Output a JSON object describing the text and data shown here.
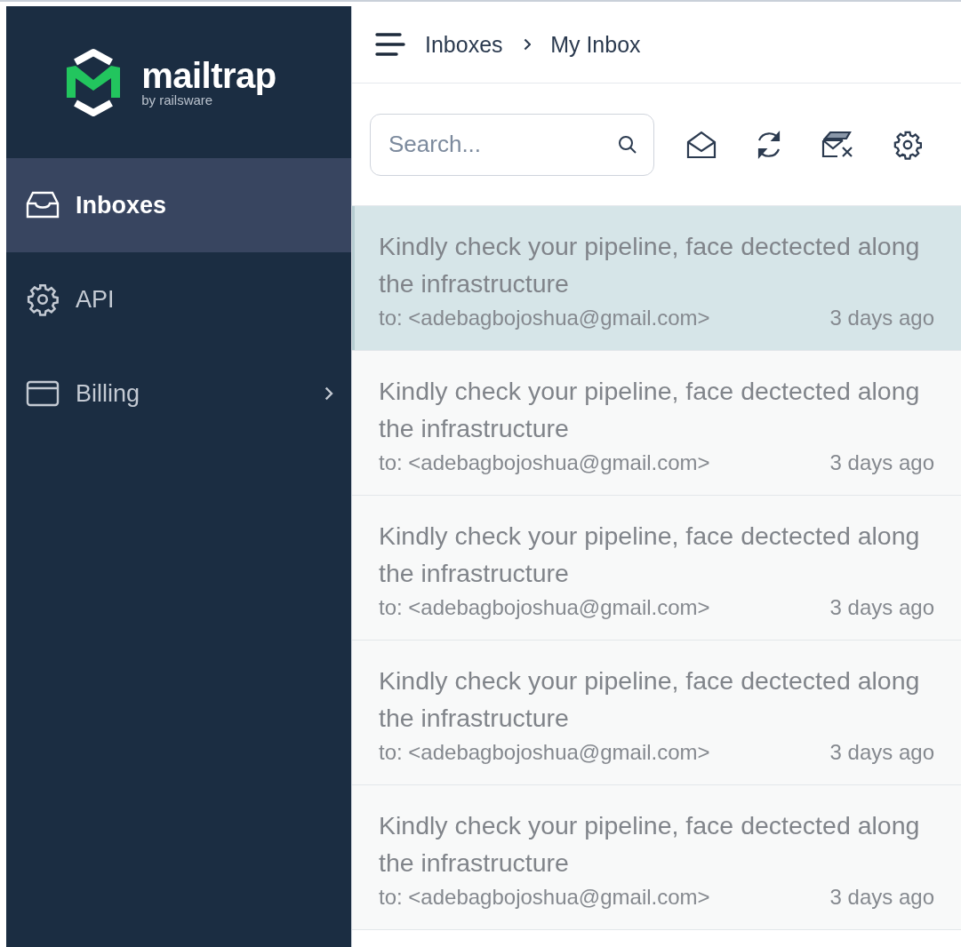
{
  "logo": {
    "name": "mailtrap",
    "tagline": "by railsware"
  },
  "sidebar": {
    "items": [
      {
        "label": "Inboxes",
        "kind": "tray",
        "selected": true,
        "expandable": false
      },
      {
        "label": "API",
        "kind": "gear",
        "selected": false,
        "expandable": false
      },
      {
        "label": "Billing",
        "kind": "card",
        "selected": false,
        "expandable": true
      }
    ]
  },
  "breadcrumb": [
    "Inboxes",
    "My Inbox"
  ],
  "search": {
    "placeholder": "Search..."
  },
  "messages": [
    {
      "subject": "Kindly check your pipeline, face dectected along the infrastructure",
      "to": "to: <adebagbojoshua@gmail.com>",
      "time": "3 days ago",
      "selected": true
    },
    {
      "subject": "Kindly check your pipeline, face dectected along the infrastructure",
      "to": "to: <adebagbojoshua@gmail.com>",
      "time": "3 days ago",
      "selected": false
    },
    {
      "subject": "Kindly check your pipeline, face dectected along the infrastructure",
      "to": "to: <adebagbojoshua@gmail.com>",
      "time": "3 days ago",
      "selected": false
    },
    {
      "subject": "Kindly check your pipeline, face dectected along the infrastructure",
      "to": "to: <adebagbojoshua@gmail.com>",
      "time": "3 days ago",
      "selected": false
    },
    {
      "subject": "Kindly check your pipeline, face dectected along the infrastructure",
      "to": "to: <adebagbojoshua@gmail.com>",
      "time": "3 days ago",
      "selected": false
    }
  ]
}
